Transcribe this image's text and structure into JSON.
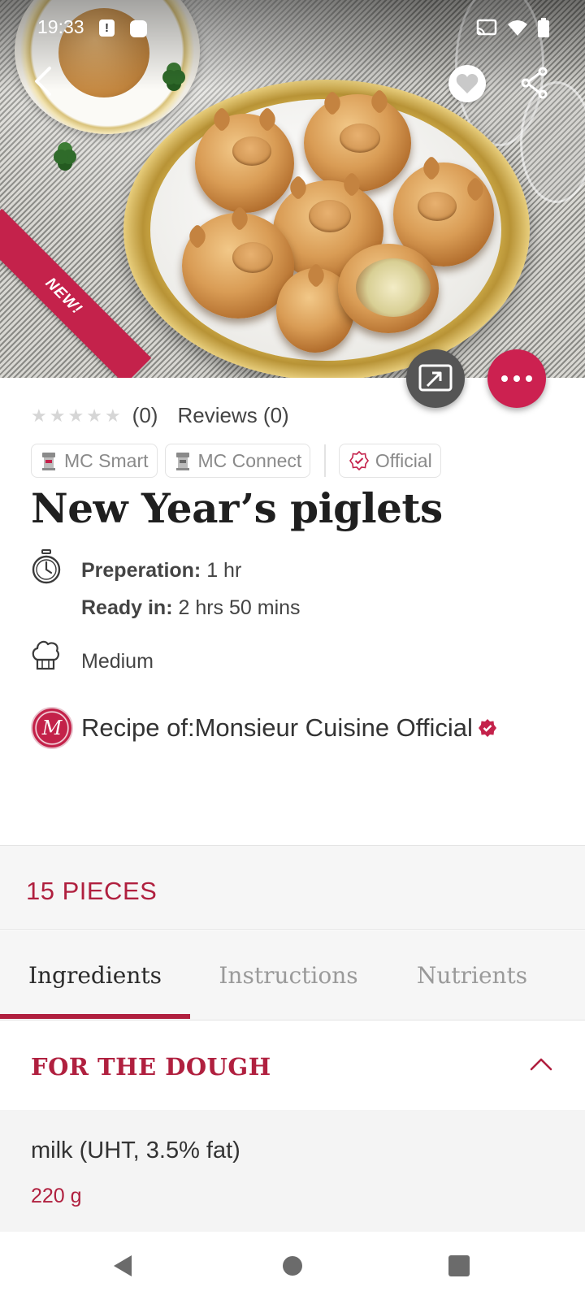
{
  "status_bar": {
    "time": "19:33",
    "alert_glyph": "!"
  },
  "hero": {
    "image_subject": "piglet-shaped stuffed buns on a gold-rimmed plate",
    "badge": "NEW!"
  },
  "rating": {
    "stars_filled": 0,
    "stars_total": 5,
    "count": "(0)",
    "reviews": "Reviews (0)"
  },
  "chips": {
    "mc_smart": "MC Smart",
    "mc_connect": "MC Connect",
    "official": "Official"
  },
  "recipe": {
    "title": "New Year’s piglets",
    "prep_label": "Preperation:",
    "prep_value": " 1 hr",
    "ready_label": "Ready in:",
    "ready_value": " 2 hrs 50 mins",
    "difficulty": "Medium",
    "author": "Recipe of:Monsieur Cuisine Official",
    "author_monogram": "M"
  },
  "servings": "15 PIECES",
  "tabs": [
    "Ingredients",
    "Instructions",
    "Nutrients"
  ],
  "section": {
    "title": "FOR THE DOUGH"
  },
  "ingredients": [
    {
      "name": "milk (UHT, 3.5% fat)",
      "quantity": "220 g"
    }
  ],
  "icons": {
    "back": "chevron-left-icon",
    "favorite": "heart-icon",
    "share": "share-icon",
    "cast": "cast-icon",
    "more": "more-dots-icon",
    "timer": "stopwatch-icon",
    "difficulty": "chef-hat-icon",
    "verified": "verified-badge-icon",
    "collapse": "chevron-up-icon"
  },
  "colors": {
    "accent": "#b0203f",
    "fab_accent": "#cc2150",
    "fab_cast": "#555555",
    "panel_bg": "#f6f6f6"
  }
}
